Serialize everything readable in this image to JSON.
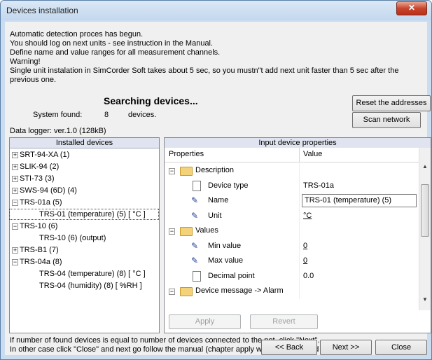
{
  "window": {
    "title": "Devices installation",
    "close_symbol": "✕"
  },
  "intro_lines": [
    "Automatic detection proces has begun.",
    "You should log on next units - see instruction in the Manual.",
    "Define name and value ranges for all measurement channels.",
    "Warning!",
    "Single unit instalation in SimCorder Soft takes about 5 sec, so you mustn\"t add next unit faster than 5 sec after the",
    "previous one."
  ],
  "status": {
    "searching": "Searching devices...",
    "system_found_label": "System found:",
    "system_found_count": "8",
    "devices_label": "devices.",
    "data_logger": "Data logger: ver.1.0 (128kB)"
  },
  "buttons": {
    "reset_addresses": "Reset the addresses",
    "scan_network": "Scan network",
    "apply": "Apply",
    "revert": "Revert",
    "back": "<< Back",
    "next": "Next >>",
    "close": "Close"
  },
  "installed_devices": {
    "header": "Installed devices",
    "items": [
      {
        "label": "SRT-94-XA (1)",
        "level": 0,
        "toggle": "+"
      },
      {
        "label": "SLIK-94 (2)",
        "level": 0,
        "toggle": "+"
      },
      {
        "label": "STI-73 (3)",
        "level": 0,
        "toggle": "+"
      },
      {
        "label": "SWS-94 (6D) (4)",
        "level": 0,
        "toggle": "+"
      },
      {
        "label": "TRS-01a (5)",
        "level": 0,
        "toggle": "−"
      },
      {
        "label": "TRS-01 (temperature) (5) [ °C ]",
        "level": 1,
        "toggle": ""
      },
      {
        "label": "TRS-10 (6)",
        "level": 0,
        "toggle": "−"
      },
      {
        "label": "TRS-10 (6) (output)",
        "level": 1,
        "toggle": ""
      },
      {
        "label": "TRS-B1 (7)",
        "level": 0,
        "toggle": "+"
      },
      {
        "label": "TRS-04a (8)",
        "level": 0,
        "toggle": "−"
      },
      {
        "label": "TRS-04 (temperature) (8) [ °C ]",
        "level": 1,
        "toggle": ""
      },
      {
        "label": "TRS-04 (humidity) (8) [ %RH ]",
        "level": 1,
        "toggle": ""
      }
    ]
  },
  "properties": {
    "header": "Input device properties",
    "col_properties": "Properties",
    "col_value": "Value",
    "rows": [
      {
        "label": "Description",
        "value": "",
        "kind": "group"
      },
      {
        "label": "Device type",
        "value": "TRS-01a",
        "kind": "doc"
      },
      {
        "label": "Name",
        "value": "TRS-01 (temperature) (5)",
        "kind": "edit"
      },
      {
        "label": "Unit",
        "value": "°C",
        "kind": "pen-ul"
      },
      {
        "label": "Values",
        "value": "",
        "kind": "group"
      },
      {
        "label": "Min value",
        "value": "0",
        "kind": "pen-ul"
      },
      {
        "label": "Max value",
        "value": "0",
        "kind": "pen-ul"
      },
      {
        "label": "Decimal point",
        "value": "0.0",
        "kind": "doc"
      },
      {
        "label": "Device message -> Alarm",
        "value": "",
        "kind": "group"
      }
    ]
  },
  "footer_lines": [
    "If number of found devices is equal to number of devices connected to the net, click \"Next\".",
    "In other case click \"Close\" and next go follow the manual (chapter apply with problems and failures)."
  ]
}
